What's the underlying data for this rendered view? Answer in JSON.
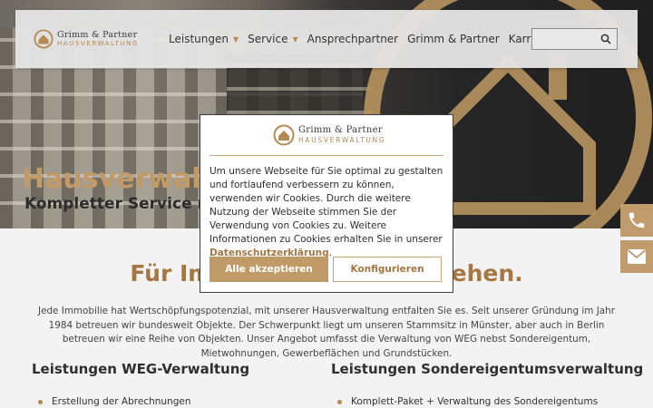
{
  "header": {
    "logo": {
      "name": "Grimm & Partner",
      "sub": "HAUSVERWALTUNG"
    },
    "nav": [
      {
        "label": "Leistungen",
        "dropdown": true
      },
      {
        "label": "Service",
        "dropdown": true
      },
      {
        "label": "Ansprechpartner",
        "dropdown": false
      },
      {
        "label": "Grimm & Partner",
        "dropdown": false
      },
      {
        "label": "Karriere",
        "dropdown": false
      }
    ],
    "search": {
      "placeholder": ""
    }
  },
  "hero": {
    "title": "Hausverwaltung",
    "subtitle": "Kompletter Service rund"
  },
  "content": {
    "heading": "Für Immobilien, die verstehen.",
    "intro": "Jede Immobilie hat Wertschöpfungspotenzial, mit unserer Hausverwaltung entfalten Sie es. Seit unserer Gründung im Jahr 1984 betreuen wir bundesweit Objekte. Der Schwerpunkt liegt um unseren Stammsitz in Münster, aber auch in Berlin betreuen wir eine Reihe von Objekten. Unser Angebot umfasst die Verwaltung von WEG nebst Sondereigentum, Mietwohnungen, Gewerbeflächen und Grundstücken.",
    "columns": [
      {
        "title": "Leistungen WEG-Verwaltung",
        "first_item": "Erstellung der Abrechnungen"
      },
      {
        "title": "Leistungen Sondereigentumsverwaltung",
        "first_item": "Komplett-Paket + Verwaltung des Sondereigentums"
      }
    ]
  },
  "cookie_modal": {
    "logo": {
      "name": "Grimm & Partner",
      "sub": "HAUSVERWALTUNG"
    },
    "text": "Um unsere Webseite für Sie optimal zu gestalten und fortlaufend verbessern zu können, verwenden wir Cookies. Durch die weitere Nutzung der Webseite stimmen Sie der Verwendung von Cookies zu. Weitere Informationen zu Cookies erhalten Sie in unserer ",
    "link": "Datenschutzerklärung",
    "text_end": ".",
    "accept_label": "Alle akzeptieren",
    "configure_label": "Konfigurieren"
  },
  "side_buttons": [
    {
      "icon": "phone-icon"
    },
    {
      "icon": "mail-icon"
    }
  ],
  "colors": {
    "accent": "#c09a67",
    "accent_dark": "#a47743"
  }
}
